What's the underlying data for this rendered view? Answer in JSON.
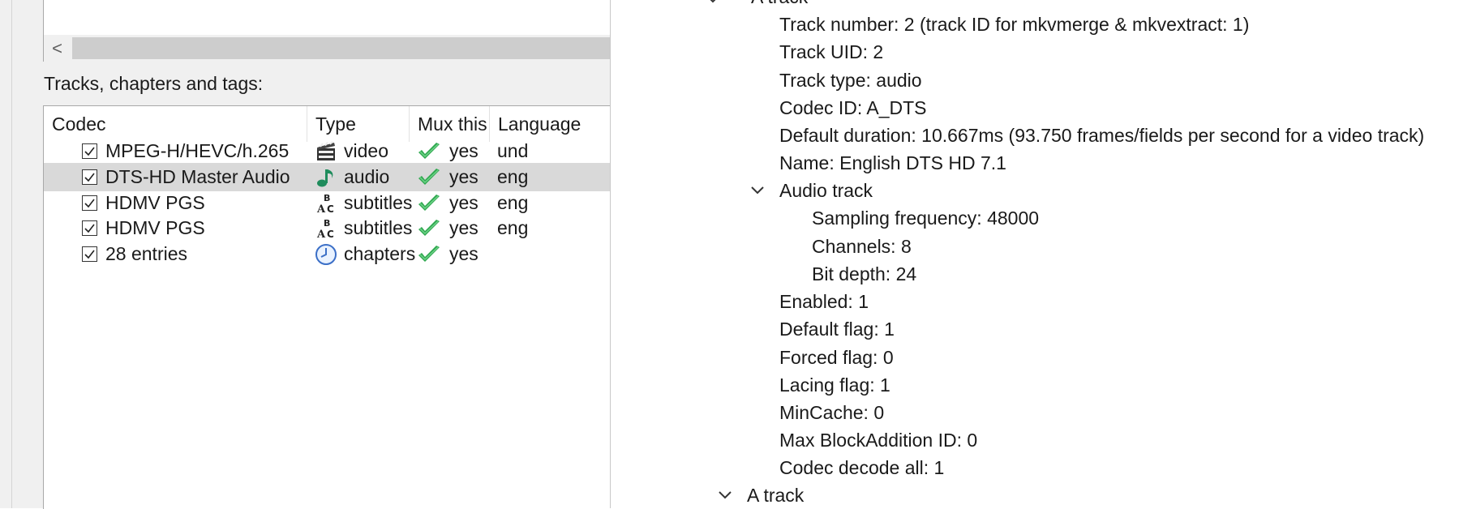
{
  "left": {
    "scroll_left_arrow": "<",
    "tracks_label": "Tracks, chapters and tags:",
    "columns": [
      "Codec",
      "Type",
      "Mux this",
      "Language"
    ],
    "rows": [
      {
        "codec": "MPEG-H/HEVC/h.265",
        "type": "video",
        "type_icon": "film-clapper-icon",
        "mux": "yes",
        "language": "und",
        "checked": true,
        "selected": false
      },
      {
        "codec": "DTS-HD Master Audio",
        "type": "audio",
        "type_icon": "music-note-icon",
        "mux": "yes",
        "language": "eng",
        "checked": true,
        "selected": true
      },
      {
        "codec": "HDMV PGS",
        "type": "subtitles",
        "type_icon": "subtitles-abc-icon",
        "mux": "yes",
        "language": "eng",
        "checked": true,
        "selected": false
      },
      {
        "codec": "HDMV PGS",
        "type": "subtitles",
        "type_icon": "subtitles-abc-icon",
        "mux": "yes",
        "language": "eng",
        "checked": true,
        "selected": false
      },
      {
        "codec": "28 entries",
        "type": "chapters",
        "type_icon": "clock-icon",
        "mux": "yes",
        "language": "",
        "checked": true,
        "selected": false
      }
    ]
  },
  "right": {
    "top_partial": "A track",
    "lines": [
      "Track number: 2 (track ID for mkvmerge & mkvextract: 1)",
      "Track UID: 2",
      "Track type: audio",
      "Codec ID: A_DTS",
      "Default duration: 10.667ms (93.750 frames/fields per second for a video track)",
      "Name: English DTS HD 7.1"
    ],
    "audio_track_label": "Audio track",
    "audio_lines": [
      "Sampling frequency: 48000",
      "Channels: 8",
      "Bit depth: 24"
    ],
    "lines2": [
      "Enabled: 1",
      "Default flag: 1",
      "Forced flag: 0",
      "Lacing flag: 1",
      "MinCache: 0",
      "Max BlockAddition ID: 0",
      "Codec decode all: 1"
    ],
    "next_track_label": "A track"
  },
  "colors": {
    "pane_bg": "#f0f0f0",
    "selected_row": "#d9d9d9",
    "check_green": "#2fa84f",
    "border": "#a8a8a8"
  }
}
